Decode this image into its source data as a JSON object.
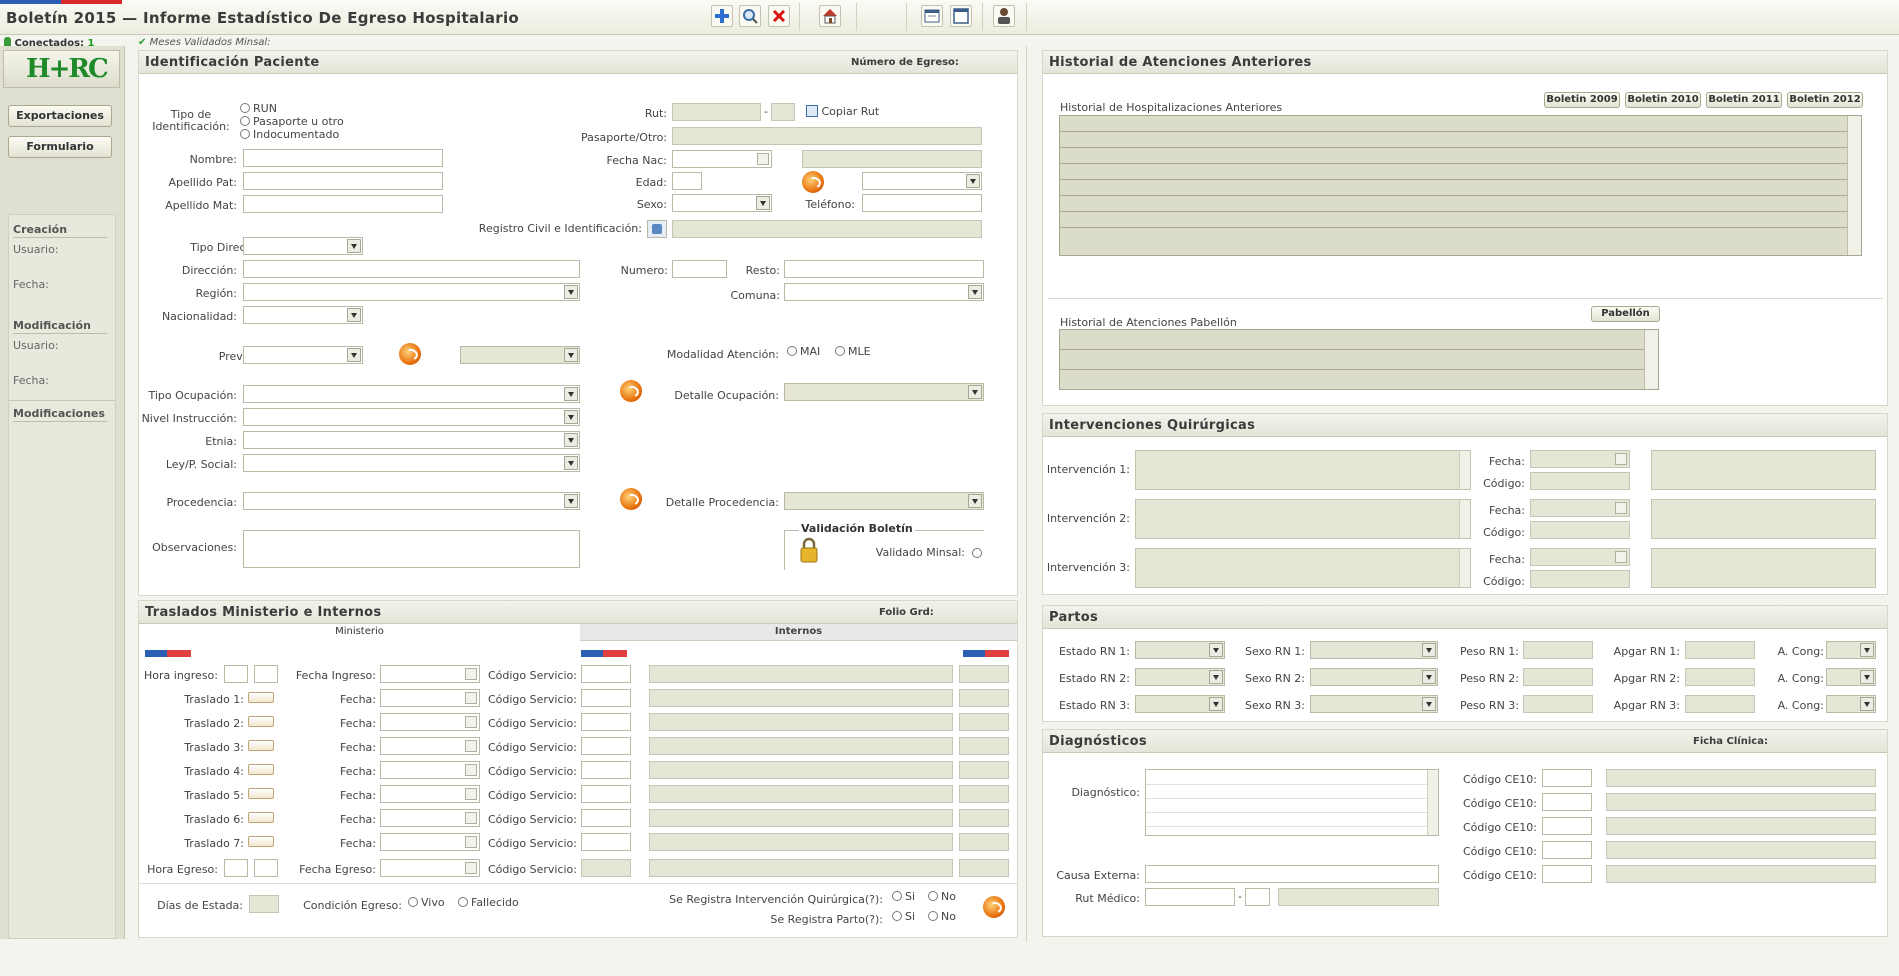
{
  "header": {
    "title": "Boletín 2015 — Informe Estadístico De Egreso Hospitalario",
    "connected_label": "Conectados:",
    "connected_count": "1",
    "validated_months": "Meses Validados Minsal:"
  },
  "toolbar": {
    "icons": [
      "add-icon",
      "search-icon",
      "delete-icon",
      "home-icon",
      "window-icon",
      "maximize-icon",
      "user-icon"
    ]
  },
  "sidebar": {
    "logo": "H+RC",
    "exports_btn": "Exportaciones",
    "form_btn": "Formulario",
    "creation_title": "Creación",
    "creation_user": "Usuario:",
    "creation_date": "Fecha:",
    "mod_title": "Modificación",
    "mod_user": "Usuario:",
    "mod_date": "Fecha:",
    "mods_title": "Modificaciones"
  },
  "patient": {
    "title": "Identificación Paciente",
    "egreso_num": "Número de Egreso:",
    "id_type_label": "Tipo de Identificación:",
    "id_type_opts": [
      "RUN",
      "Pasaporte u otro",
      "Indocumentado"
    ],
    "nombre": "Nombre:",
    "apellido_pat": "Apellido Pat:",
    "apellido_mat": "Apellido Mat:",
    "rut": "Rut:",
    "rut_dash": "-",
    "copy_rut": "Copiar Rut",
    "pasaporte": "Pasaporte/Otro:",
    "fecha_nac": "Fecha Nac:",
    "edad": "Edad:",
    "sexo": "Sexo:",
    "telefono": "Teléfono:",
    "registro_civil": "Registro Civil e Identificación:",
    "tipo_direccion": "Tipo Dirección:",
    "direccion": "Dirección:",
    "numero": "Numero:",
    "resto": "Resto:",
    "region": "Región:",
    "comuna": "Comuna:",
    "nacionalidad": "Nacionalidad:",
    "prevision": "Previsión:",
    "modalidad": "Modalidad Atención:",
    "modalidad_opts": [
      "MAI",
      "MLE"
    ],
    "tipo_ocupacion": "Tipo Ocupación:",
    "detalle_ocupacion": "Detalle Ocupación:",
    "nivel_instruccion": "Nivel Instrucción:",
    "etnia": "Etnia:",
    "ley_social": "Ley/P. Social:",
    "procedencia": "Procedencia:",
    "detalle_procedencia": "Detalle Procedencia:",
    "observaciones": "Observaciones:",
    "validacion_title": "Validación Boletín",
    "validado_minsal": "Validado Minsal:"
  },
  "traslados": {
    "title": "Traslados Ministerio e Internos",
    "folio": "Folio Grd:",
    "tab_ministerio": "Ministerio",
    "tab_internos": "Internos",
    "hora_ingreso": "Hora ingreso:",
    "fecha_ingreso": "Fecha Ingreso:",
    "codigo_servicio": "Código Servicio:",
    "fecha": "Fecha:",
    "rows": [
      "Traslado 1:",
      "Traslado 2:",
      "Traslado 3:",
      "Traslado 4:",
      "Traslado 5:",
      "Traslado 6:",
      "Traslado 7:"
    ],
    "hora_egreso": "Hora Egreso:",
    "fecha_egreso": "Fecha Egreso:",
    "dias_estada": "Días de Estada:",
    "condicion_egreso": "Condición Egreso:",
    "condicion_opts": [
      "Vivo",
      "Fallecido"
    ],
    "reg_intervencion": "Se Registra Intervención Quirúrgica(?):",
    "reg_parto": "Se Registra Parto(?):",
    "si": "Si",
    "no": "No"
  },
  "historial": {
    "title": "Historial de Atenciones Anteriores",
    "hosp_label": "Historial de Hospitalizaciones Anteriores",
    "boletin_btns": [
      "Boletin 2009",
      "Boletin 2010",
      "Boletin 2011",
      "Boletin 2012"
    ],
    "pabellon_label": "Historial de Atenciones Pabellón",
    "pabellon_btn": "Pabellón"
  },
  "intervenciones": {
    "title": "Intervenciones Quirúrgicas",
    "rows": [
      "Intervención 1:",
      "Intervención 2:",
      "Intervención 3:"
    ],
    "fecha": "Fecha:",
    "codigo": "Código:"
  },
  "partos": {
    "title": "Partos",
    "estado": [
      "Estado RN 1:",
      "Estado RN 2:",
      "Estado RN 3:"
    ],
    "sexo": [
      "Sexo RN 1:",
      "Sexo RN 2:",
      "Sexo RN 3:"
    ],
    "peso": [
      "Peso RN 1:",
      "Peso RN 2:",
      "Peso RN 3:"
    ],
    "apgar": [
      "Apgar RN 1:",
      "Apgar RN 2:",
      "Apgar RN 3:"
    ],
    "acong": "A. Cong:"
  },
  "diagnosticos": {
    "title": "Diagnósticos",
    "ficha": "Ficha Clínica:",
    "diagnostico": "Diagnóstico:",
    "codigo_ce10": "Código CE10:",
    "causa_externa": "Causa Externa:",
    "rut_medico": "Rut Médico:",
    "rut_dash": "-"
  },
  "colors": {
    "accent": "#1e9a1e",
    "panel_head": "#e4e4d8",
    "disabled": "#e6e6d6"
  }
}
